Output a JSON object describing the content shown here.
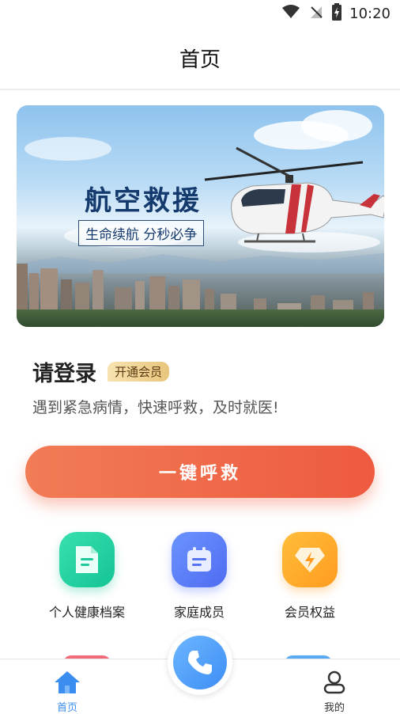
{
  "status": {
    "time": "10:20"
  },
  "header": {
    "title": "首页"
  },
  "banner": {
    "headline": "航空救援",
    "slogan": "生命续航 分秒必争"
  },
  "login": {
    "title": "请登录",
    "vip_badge": "开通会员",
    "subtitle": "遇到紧急病情，快速呼救，及时就医!"
  },
  "sos_button": {
    "label": "一键呼救"
  },
  "quick_actions": [
    {
      "label": "个人健康档案",
      "icon": "document-icon",
      "color": "#1dc99a"
    },
    {
      "label": "家庭成员",
      "icon": "calendar-icon",
      "color": "#5573f3"
    },
    {
      "label": "会员权益",
      "icon": "diamond-icon",
      "color": "#ffa526"
    }
  ],
  "tabs": [
    {
      "label": "首页",
      "icon": "home-icon",
      "active": true,
      "color": "#3b8ef0"
    },
    {
      "label": "我的",
      "icon": "user-icon",
      "active": false
    }
  ],
  "call_button": {
    "icon": "phone-icon",
    "color": "#3d8ef5"
  }
}
